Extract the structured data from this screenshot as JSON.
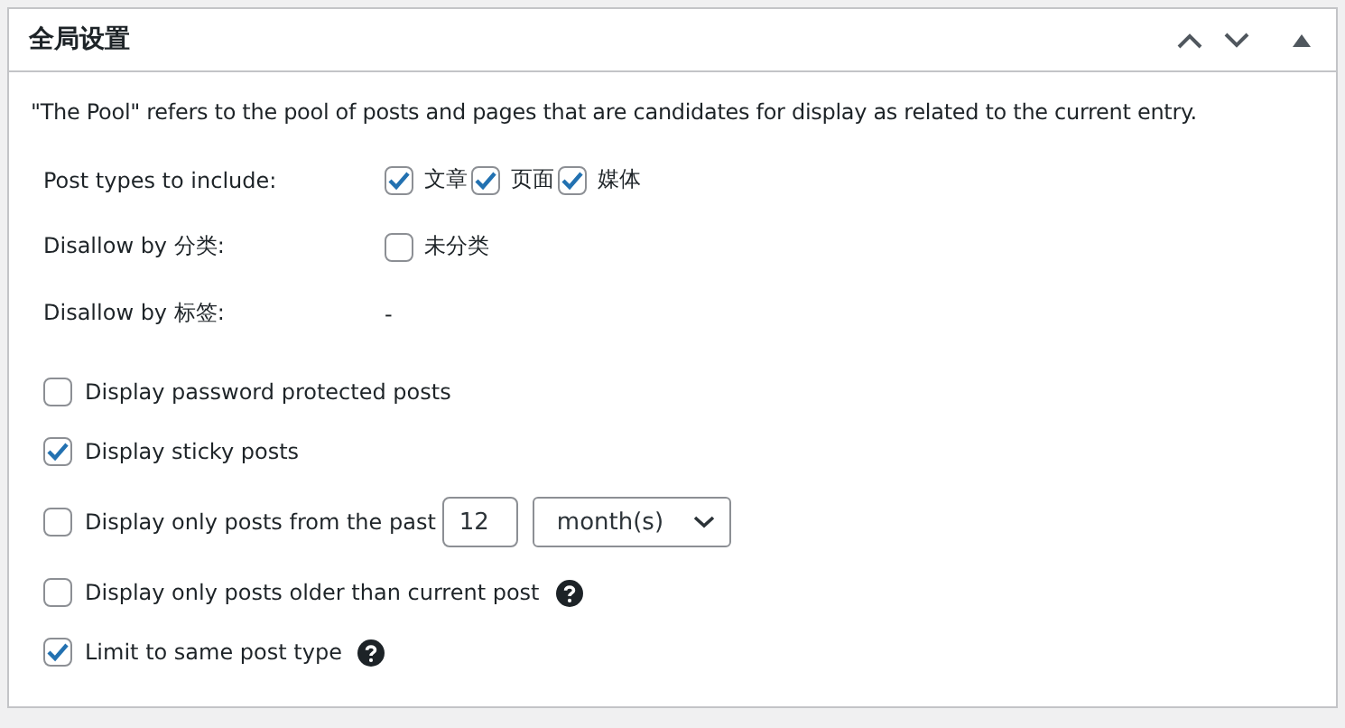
{
  "panel": {
    "title": "全局设置"
  },
  "description": "\"The Pool\" refers to the pool of posts and pages that are candidates for display as related to the current entry.",
  "settings": [
    {
      "label": "Post types to include:",
      "kind": "checkboxes",
      "options": [
        {
          "label": "文章",
          "checked": true
        },
        {
          "label": "页面",
          "checked": true
        },
        {
          "label": "媒体",
          "checked": true
        }
      ]
    },
    {
      "label": "Disallow by 分类:",
      "kind": "checkboxes",
      "options": [
        {
          "label": "未分类",
          "checked": false
        }
      ]
    },
    {
      "label": "Disallow by 标签:",
      "kind": "text",
      "value": "-"
    }
  ],
  "options": [
    {
      "label": "Display password protected posts",
      "checked": false,
      "help": false
    },
    {
      "label": "Display sticky posts",
      "checked": true,
      "help": false
    },
    {
      "label": "Display only posts from the past",
      "checked": false,
      "help": false,
      "number": "12",
      "unit": "month(s)"
    },
    {
      "label": "Display only posts older than current post",
      "checked": false,
      "help": true
    },
    {
      "label": "Limit to same post type",
      "checked": true,
      "help": true
    }
  ]
}
